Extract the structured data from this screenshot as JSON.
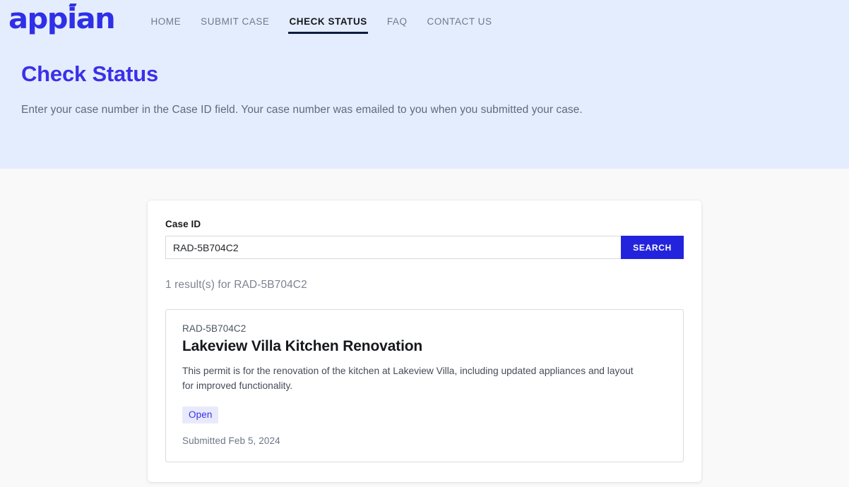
{
  "brand": {
    "logo_text_before": "app",
    "logo_text_accent": "i",
    "logo_text_after": "an",
    "logo_full": "appian",
    "logo_color": "#2f2fe8"
  },
  "nav": {
    "items": [
      {
        "label": "HOME",
        "active": false
      },
      {
        "label": "SUBMIT CASE",
        "active": false
      },
      {
        "label": "CHECK STATUS",
        "active": true
      },
      {
        "label": "FAQ",
        "active": false
      },
      {
        "label": "CONTACT US",
        "active": false
      }
    ]
  },
  "hero": {
    "title": "Check Status",
    "subtitle": "Enter your case number in the Case ID field. Your case number was emailed to you when you submitted your case.",
    "background_color": "#e4edfd",
    "title_color": "#3b30e8"
  },
  "search": {
    "field_label": "Case ID",
    "input_value": "RAD-5B704C2",
    "input_placeholder": "Case ID",
    "button_label": "SEARCH",
    "button_color": "#2323dd",
    "result_count_text": "1 result(s) for RAD-5B704C2"
  },
  "results": [
    {
      "case_id": "RAD-5B704C2",
      "title": "Lakeview Villa Kitchen Renovation",
      "description": "This permit is for the renovation of the kitchen at Lakeview Villa, including updated appliances and layout for improved functionality.",
      "status": "Open",
      "status_bg": "#e8eafc",
      "status_color": "#3b30e8",
      "submitted": "Submitted Feb 5, 2024"
    }
  ]
}
